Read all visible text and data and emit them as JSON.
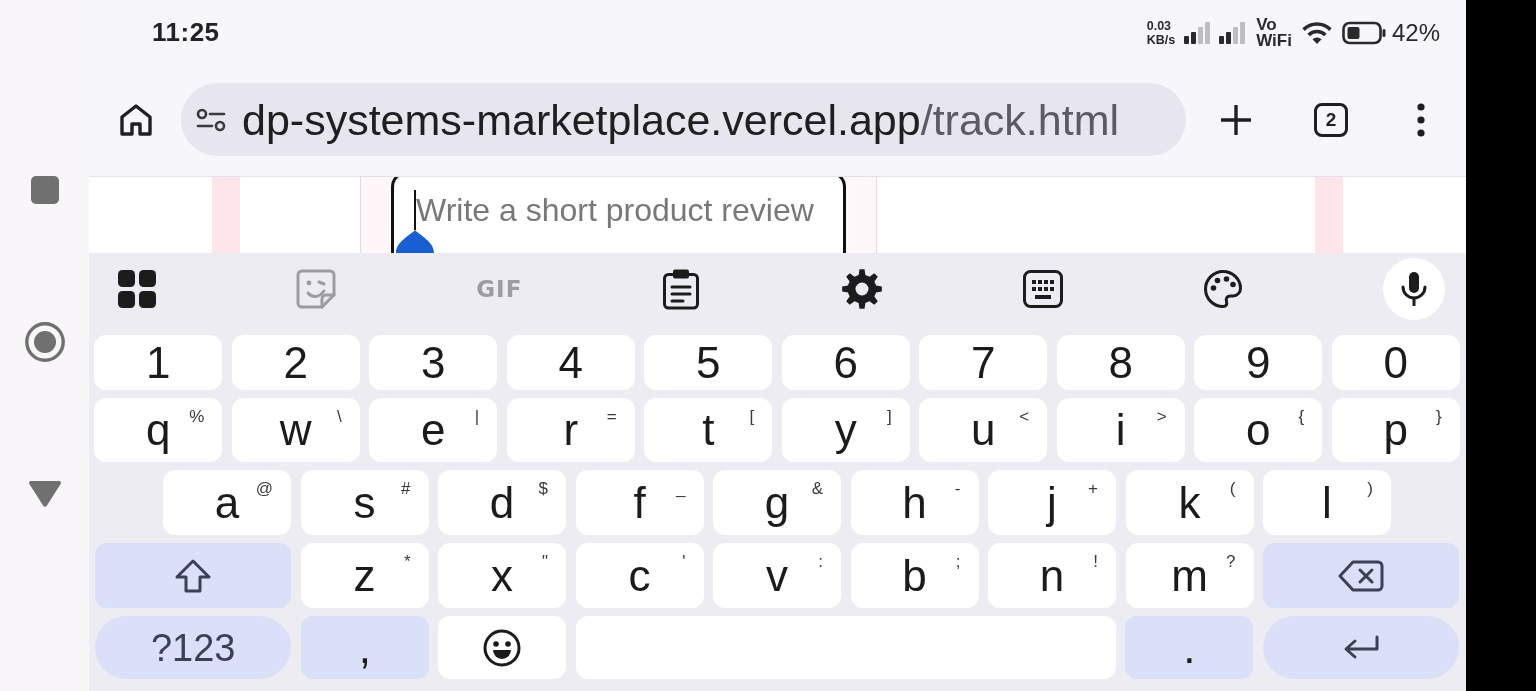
{
  "status_bar": {
    "time": "11:25",
    "network_speed": [
      "0.03",
      "KB/s"
    ],
    "vowifi": [
      "Vo",
      "WiFi"
    ],
    "battery_percent": "42%"
  },
  "browser": {
    "url": {
      "host": "dp-systems-marketplace.vercel.app",
      "path": "/track.html"
    },
    "tab_count": "2"
  },
  "page": {
    "review_field": {
      "placeholder": "Write a short product review"
    }
  },
  "keyboard": {
    "toolbar": [
      {
        "kind": "apps",
        "disabled": false
      },
      {
        "kind": "stickers",
        "disabled": true
      },
      {
        "kind": "gif",
        "label": "GIF",
        "disabled": true
      },
      {
        "kind": "clipboard",
        "disabled": false
      },
      {
        "kind": "settings",
        "disabled": false
      },
      {
        "kind": "keypad",
        "disabled": false
      },
      {
        "kind": "theme",
        "disabled": false
      },
      {
        "kind": "voice",
        "disabled": false
      }
    ],
    "rows": [
      [
        {
          "kind": "char",
          "label": "1"
        },
        {
          "kind": "char",
          "label": "2"
        },
        {
          "kind": "char",
          "label": "3"
        },
        {
          "kind": "char",
          "label": "4"
        },
        {
          "kind": "char",
          "label": "5"
        },
        {
          "kind": "char",
          "label": "6"
        },
        {
          "kind": "char",
          "label": "7"
        },
        {
          "kind": "char",
          "label": "8"
        },
        {
          "kind": "char",
          "label": "9"
        },
        {
          "kind": "char",
          "label": "0"
        }
      ],
      [
        {
          "kind": "char",
          "label": "q",
          "hint": "%"
        },
        {
          "kind": "char",
          "label": "w",
          "hint": "\\"
        },
        {
          "kind": "char",
          "label": "e",
          "hint": "|"
        },
        {
          "kind": "char",
          "label": "r",
          "hint": "="
        },
        {
          "kind": "char",
          "label": "t",
          "hint": "["
        },
        {
          "kind": "char",
          "label": "y",
          "hint": "]"
        },
        {
          "kind": "char",
          "label": "u",
          "hint": "<"
        },
        {
          "kind": "char",
          "label": "i",
          "hint": ">"
        },
        {
          "kind": "char",
          "label": "o",
          "hint": "{"
        },
        {
          "kind": "char",
          "label": "p",
          "hint": "}"
        }
      ],
      [
        {
          "kind": "char",
          "label": "a",
          "hint": "@"
        },
        {
          "kind": "char",
          "label": "s",
          "hint": "#"
        },
        {
          "kind": "char",
          "label": "d",
          "hint": "$"
        },
        {
          "kind": "char",
          "label": "f",
          "hint": "_"
        },
        {
          "kind": "char",
          "label": "g",
          "hint": "&"
        },
        {
          "kind": "char",
          "label": "h",
          "hint": "-"
        },
        {
          "kind": "char",
          "label": "j",
          "hint": "+"
        },
        {
          "kind": "char",
          "label": "k",
          "hint": "("
        },
        {
          "kind": "char",
          "label": "l",
          "hint": ")"
        }
      ],
      [
        {
          "kind": "shift"
        },
        {
          "kind": "char",
          "label": "z",
          "hint": "*"
        },
        {
          "kind": "char",
          "label": "x",
          "hint": "\""
        },
        {
          "kind": "char",
          "label": "c",
          "hint": "'"
        },
        {
          "kind": "char",
          "label": "v",
          "hint": ":"
        },
        {
          "kind": "char",
          "label": "b",
          "hint": ";"
        },
        {
          "kind": "char",
          "label": "n",
          "hint": "!"
        },
        {
          "kind": "char",
          "label": "m",
          "hint": "?"
        },
        {
          "kind": "backspace"
        }
      ],
      [
        {
          "kind": "mode",
          "label": "?123"
        },
        {
          "kind": "punct",
          "label": ","
        },
        {
          "kind": "emoji"
        },
        {
          "kind": "space"
        },
        {
          "kind": "punct",
          "label": "."
        },
        {
          "kind": "enter"
        }
      ]
    ]
  }
}
